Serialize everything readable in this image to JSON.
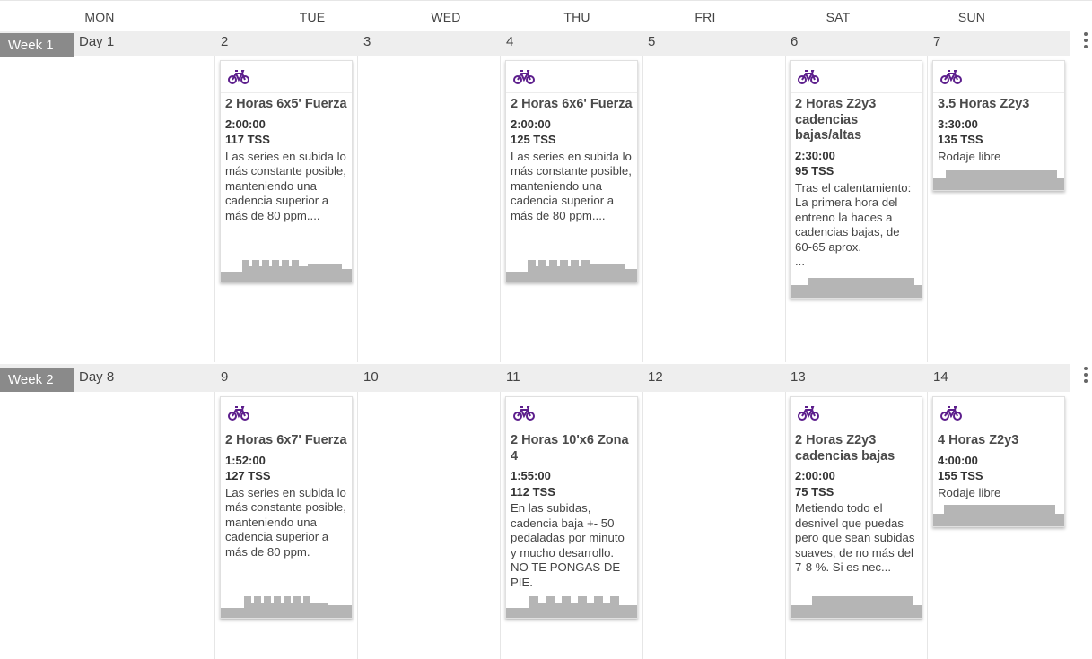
{
  "day_headers": [
    "MON",
    "TUE",
    "WED",
    "THU",
    "FRI",
    "SAT",
    "SUN"
  ],
  "colors": {
    "bike_icon": "#5c1e8c",
    "week_label_bg": "#8a8a8a",
    "week_band_bg": "#eeeeee",
    "profile_fill": "#b5b5b5"
  },
  "weeks": [
    {
      "label": "Week 1",
      "days": [
        "Day 1",
        "2",
        "3",
        "4",
        "5",
        "6",
        "7"
      ],
      "workouts": [
        {
          "day_index": 1,
          "sport_icon": "bike-icon",
          "title": "2 Horas 6x5' Fuerza",
          "duration": "2:00:00",
          "tss": "117 TSS",
          "description": "Las series en subida lo más constante posible, manteniendo una cadencia superior a más de 80 ppm...."
        },
        {
          "day_index": 3,
          "sport_icon": "bike-icon",
          "title": "2 Horas 6x6' Fuerza",
          "duration": "2:00:00",
          "tss": "125 TSS",
          "description": "Las series en subida lo más constante posible, manteniendo una cadencia superior a más de 80 ppm...."
        },
        {
          "day_index": 5,
          "sport_icon": "bike-icon",
          "title": "2 Horas Z2y3 cadencias bajas/altas",
          "duration": "2:30:00",
          "tss": "95 TSS",
          "description": "Tras el calentamiento: La primera hora del entreno la haces a cadencias bajas, de 60-65 aprox.\n..."
        },
        {
          "day_index": 6,
          "sport_icon": "bike-icon",
          "title": "3.5 Horas Z2y3",
          "duration": "3:30:00",
          "tss": "135 TSS",
          "description": "Rodaje libre"
        }
      ]
    },
    {
      "label": "Week 2",
      "days": [
        "Day 8",
        "9",
        "10",
        "11",
        "12",
        "13",
        "14"
      ],
      "workouts": [
        {
          "day_index": 1,
          "sport_icon": "bike-icon",
          "title": "2 Horas 6x7' Fuerza",
          "duration": "1:52:00",
          "tss": "127 TSS",
          "description": "Las series en subida lo más constante posible, manteniendo una cadencia superior a más de 80 ppm."
        },
        {
          "day_index": 3,
          "sport_icon": "bike-icon",
          "title": "2 Horas 10'x6 Zona 4",
          "duration": "1:55:00",
          "tss": "112 TSS",
          "description": "En las subidas, cadencia baja +- 50 pedaladas por minuto y mucho desarrollo. NO TE PONGAS DE PIE."
        },
        {
          "day_index": 5,
          "sport_icon": "bike-icon",
          "title": "2 Horas Z2y3 cadencias bajas",
          "duration": "2:00:00",
          "tss": "75 TSS",
          "description": "Metiendo todo el desnivel que puedas pero que sean subidas suaves, de no más del 7-8 %. Si es nec..."
        },
        {
          "day_index": 6,
          "sport_icon": "bike-icon",
          "title": "4 Horas Z2y3",
          "duration": "4:00:00",
          "tss": "155 TSS",
          "description": "Rodaje libre"
        }
      ]
    }
  ]
}
